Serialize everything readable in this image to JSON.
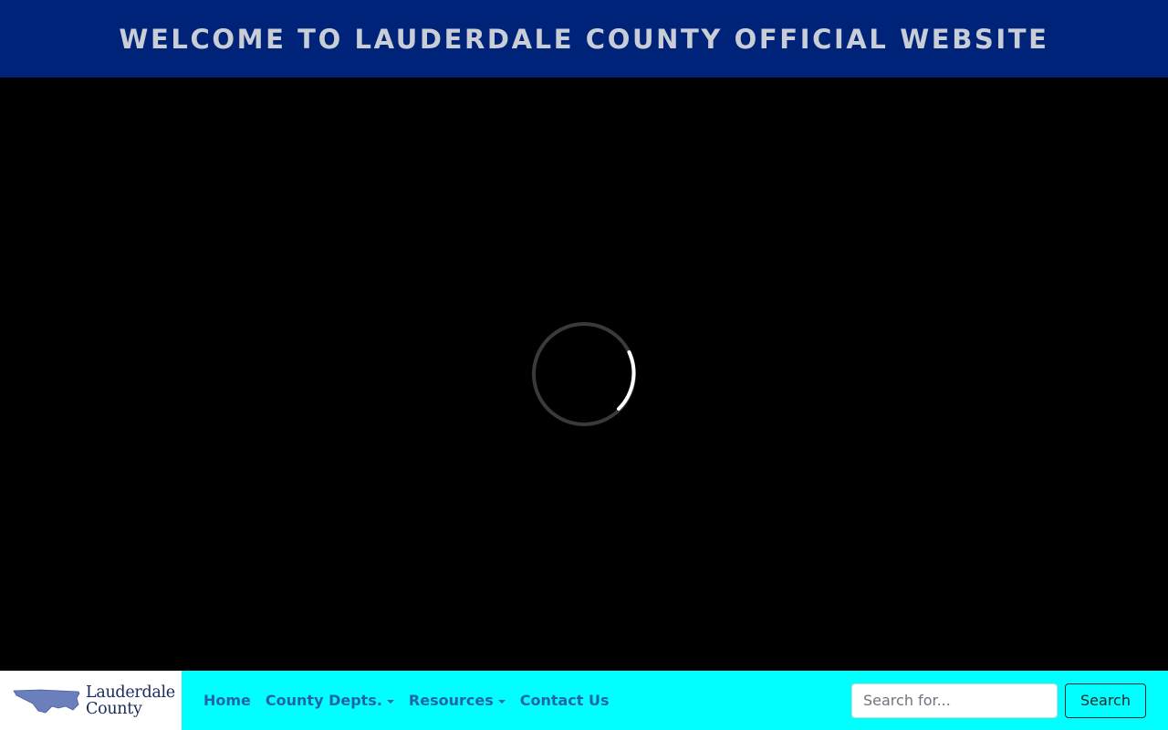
{
  "banner": {
    "title": "WELCOME TO LAUDERDALE COUNTY OFFICIAL WEBSITE"
  },
  "video": {
    "loading_icon": "spinner-icon"
  },
  "navbar": {
    "logo": {
      "line1": "Lauderdale",
      "line2": "County",
      "icon": "county-map-icon"
    },
    "links": [
      {
        "label": "Home",
        "dropdown": false
      },
      {
        "label": "County Depts.",
        "dropdown": true
      },
      {
        "label": "Resources",
        "dropdown": true
      },
      {
        "label": "Contact Us",
        "dropdown": false
      }
    ],
    "search": {
      "placeholder": "Search for...",
      "value": "",
      "button_label": "Search"
    }
  },
  "colors": {
    "banner_bg": "#00237a",
    "banner_text": "#c9cdd6",
    "navbar_bg": "#00ffff",
    "nav_link": "#1f64a8",
    "logo_map": "#6b7fbd"
  }
}
